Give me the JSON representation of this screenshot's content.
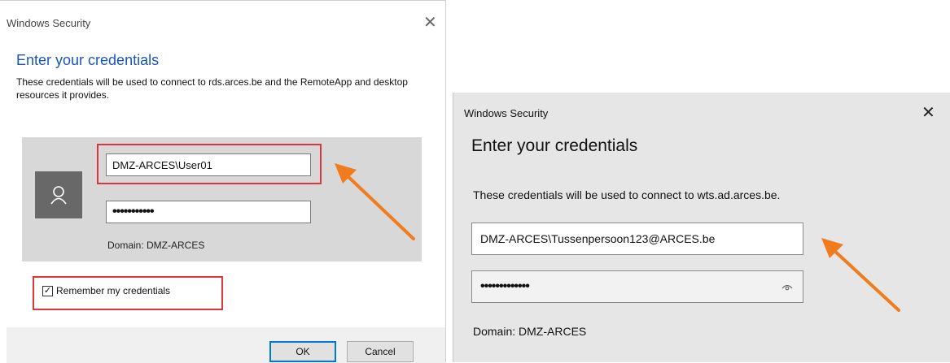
{
  "left_dialog": {
    "window_title": "Windows Security",
    "close_glyph": "✕",
    "heading": "Enter your credentials",
    "description": "These credentials will be used to connect to rds.arces.be and the RemoteApp and desktop resources it provides.",
    "username_value": "DMZ-ARCES\\User01",
    "password_mask": "•••••••••••",
    "domain": "Domain: DMZ-ARCES",
    "remember_label": "Remember my credentials",
    "remember_checked": true,
    "ok_label": "OK",
    "cancel_label": "Cancel",
    "avatar_icon": "user-icon"
  },
  "right_dialog": {
    "window_title": "Windows Security",
    "close_glyph": "✕",
    "heading": "Enter your credentials",
    "description": "These credentials will be used to connect to wts.ad.arces.be.",
    "username_value": "DMZ-ARCES\\Tussenpersoon123@ARCES.be",
    "password_mask": "•••••••••••••",
    "domain": "Domain: DMZ-ARCES",
    "reveal_icon": "eye-icon"
  },
  "annotations": {
    "highlight_color": "#d9363e",
    "arrow_color": "#f07c1e"
  }
}
